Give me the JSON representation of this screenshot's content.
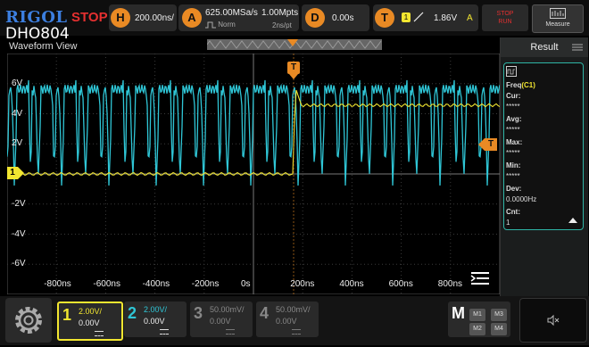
{
  "brand": "RIGOL",
  "run_state": "STOP",
  "model": "DHO804",
  "header": {
    "horizontal": {
      "letter": "H",
      "value": "200.00ns/"
    },
    "acquire": {
      "letter": "A",
      "rate": "625.00MSa/s",
      "points": "1.00Mpts",
      "mode": "Norm",
      "per_point": "2ns/pt"
    },
    "delay": {
      "letter": "D",
      "value": "0.00s"
    },
    "trigger": {
      "letter": "T",
      "channel": "1",
      "level": "1.86V",
      "coupling": "A"
    },
    "buttons": {
      "stop_run": "STOP\nRUN",
      "measure": "Measure"
    }
  },
  "waveform_title": "Waveform View",
  "y_axis_labels": [
    "6V",
    "4V",
    "2V",
    "-2V",
    "-4V",
    "-6V"
  ],
  "x_axis_labels": [
    "-800ns",
    "-600ns",
    "-400ns",
    "-200ns",
    "0s",
    "200ns",
    "400ns",
    "600ns",
    "800ns"
  ],
  "markers": {
    "trigger_top": "T",
    "trigger_level": "T",
    "ch1_ref": "1"
  },
  "result_panel": {
    "title": "Result",
    "measurement": "Freq",
    "source": "(C1)",
    "items": [
      {
        "label": "Cur:",
        "value": "*****"
      },
      {
        "label": "Avg:",
        "value": "*****"
      },
      {
        "label": "Max:",
        "value": "*****"
      },
      {
        "label": "Min:",
        "value": "*****"
      },
      {
        "label": "Dev:",
        "value": "0.0000Hz"
      },
      {
        "label": "Cnt:",
        "value": "1"
      }
    ]
  },
  "channels": [
    {
      "num": "1",
      "scale": "2.00V/",
      "offset": "0.00V",
      "color": "#f2e630",
      "active": true
    },
    {
      "num": "2",
      "scale": "2.00V/",
      "offset": "0.00V",
      "color": "#2fc6d6",
      "active": true
    },
    {
      "num": "3",
      "scale": "50.00mV/",
      "offset": "0.00V",
      "color": "#888888",
      "active": false
    },
    {
      "num": "4",
      "scale": "50.00mV/",
      "offset": "0.00V",
      "color": "#888888",
      "active": false
    }
  ],
  "math": {
    "label": "M",
    "buttons": [
      "M1",
      "M3",
      "M2",
      "M4"
    ]
  },
  "colors": {
    "ch1": "#f2e630",
    "ch2": "#2fc6d6",
    "accent": "#e98a24",
    "stop": "#e53030",
    "result_border": "#2fb5a6"
  }
}
